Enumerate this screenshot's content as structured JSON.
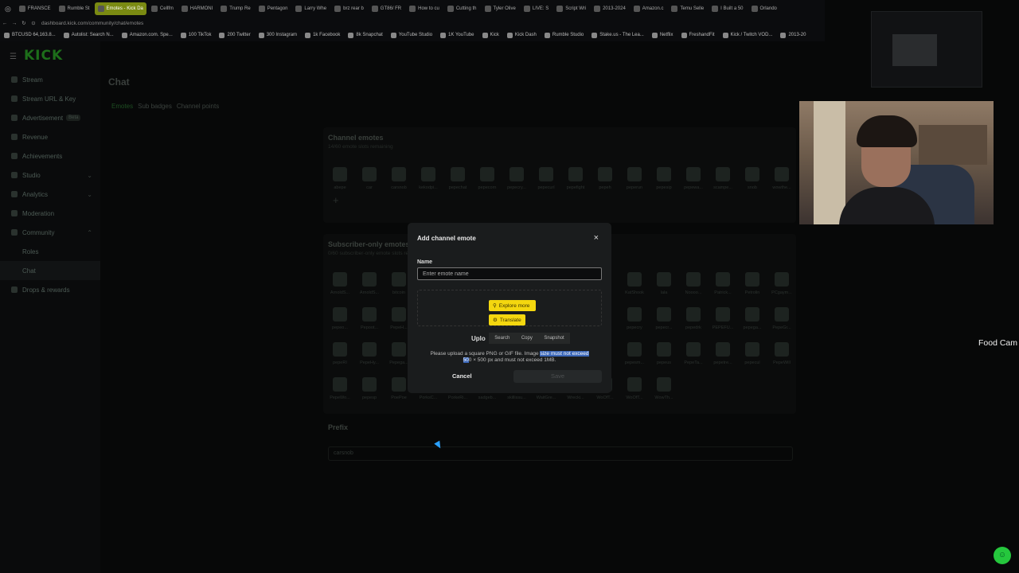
{
  "browser": {
    "tabs": [
      {
        "label": "FRANSCE"
      },
      {
        "label": "Rumble St"
      },
      {
        "label": "Emotes - Kick Da",
        "active": true
      },
      {
        "label": "Cellfm"
      },
      {
        "label": "HARMONI"
      },
      {
        "label": "Trump Re"
      },
      {
        "label": "Pentagon"
      },
      {
        "label": "Larry Whe"
      },
      {
        "label": "brz rear b"
      },
      {
        "label": "GT86/ FR"
      },
      {
        "label": "How to cu"
      },
      {
        "label": "Cutting th"
      },
      {
        "label": "Tyler Olive"
      },
      {
        "label": "LIVE: S"
      },
      {
        "label": "Script Wri"
      },
      {
        "label": "2013-2024"
      },
      {
        "label": "Amazon.c"
      },
      {
        "label": "Temu Selle"
      },
      {
        "label": "I Built a 50"
      },
      {
        "label": "Orlando"
      }
    ],
    "url": "dashboard.kick.com/community/chat/emotes",
    "bookmarks": [
      "BTCUSD 64,163.8...",
      "Autolist: Search N...",
      "Amazon.com. Spe...",
      "100 TikTok",
      "200 Twitter",
      "300 Instagram",
      "1k Facebook",
      "8k Snapchat",
      "YouTube Studio",
      "1K YouTube",
      "Kick",
      "Kick Dash",
      "Rumble Studio",
      "Stake.us - The Lea...",
      "Netflix",
      "FreshandFit",
      "Kick / Twitch VOD...",
      "2013-20"
    ]
  },
  "sidebar": {
    "logo": "KICK",
    "items": [
      {
        "label": "Stream"
      },
      {
        "label": "Stream URL & Key"
      },
      {
        "label": "Advertisement",
        "badge": "Beta"
      },
      {
        "label": "Revenue"
      },
      {
        "label": "Achievements"
      },
      {
        "label": "Studio",
        "chevron": "⌄"
      },
      {
        "label": "Analytics",
        "chevron": "⌄"
      },
      {
        "label": "Moderation"
      },
      {
        "label": "Community",
        "chevron": "⌃"
      },
      {
        "label": "Roles",
        "sub": true
      },
      {
        "label": "Chat",
        "sub": true,
        "active": true
      },
      {
        "label": "Drops & rewards"
      }
    ]
  },
  "main": {
    "title": "Chat",
    "tabs": [
      "Emotes",
      "Sub badges",
      "Channel points"
    ],
    "channel_emotes": {
      "title": "Channel emotes",
      "subtitle": "14/60 emote slots remaining",
      "emotes": [
        "abepe",
        "car",
        "carsnob",
        "kekodpi...",
        "pepechat",
        "pepecorn",
        "pepecry...",
        "pepecurl",
        "pepefight",
        "pepeh",
        "peperun",
        "pepesip",
        "pepewa...",
        "scampe...",
        "snob",
        "wowthe..."
      ]
    },
    "subscriber_emotes": {
      "title": "Subscriber-only emotes",
      "subtitle": "0/60 subscriber-only emote slots remaining",
      "emotes": [
        [
          "ArnoldS...",
          "ArnoldS...",
          "bitcoin",
          "",
          "",
          "",
          "",
          "",
          "",
          "",
          "KatShook",
          "lala",
          "Noooo...",
          "Patrick...",
          "Petrolin",
          "PCgaym..."
        ],
        [
          "pepeo...",
          "Pepoot...",
          "PepeH...",
          "",
          "",
          "",
          "",
          "",
          "",
          "",
          "pepecry",
          "pepecr...",
          "pepedrk",
          "PEPEFU...",
          "pepega...",
          "PepeGr..."
        ],
        [
          "pepeRI",
          "PepeHy...",
          "Pepega...",
          "",
          "",
          "",
          "",
          "",
          "",
          "",
          "pepesm...",
          "pepeus",
          "PepeTa...",
          "pepetre...",
          "pepecul",
          "PepeWill"
        ],
        [
          "PepeWo...",
          "pepesp",
          "PoePoe",
          "PorksC...",
          "PorkeRi...",
          "sadgeb...",
          "skillissu...",
          "WaitGre...",
          "Wrecki...",
          "WoOfT...",
          "WoOfT...",
          "WowTh..."
        ]
      ]
    },
    "prefix": {
      "title": "Prefix",
      "value": "carsnob"
    }
  },
  "modal": {
    "title": "Add channel emote",
    "close_icon": "×",
    "name_label": "Name",
    "name_placeholder": "Enter emote name",
    "upload_title": "Uplo",
    "desc_a": "Please upload a square PNG or GIF file. Image ",
    "desc_hl1": "size must not exceed",
    "desc_hl2": "50",
    "desc_b": "0 × 500 px and must not exceed 1MB.",
    "cancel": "Cancel",
    "save": "Save"
  },
  "context_popup": {
    "explore_more": "Explore more",
    "translate": "Translate",
    "actions": [
      "Search",
      "Copy",
      "Snapshot"
    ]
  },
  "overlay": {
    "food_cam": "Food Cam"
  },
  "colors": {
    "kick_green": "#53fc18",
    "highlight": "#f4d70f",
    "selection": "#3b67b8"
  }
}
